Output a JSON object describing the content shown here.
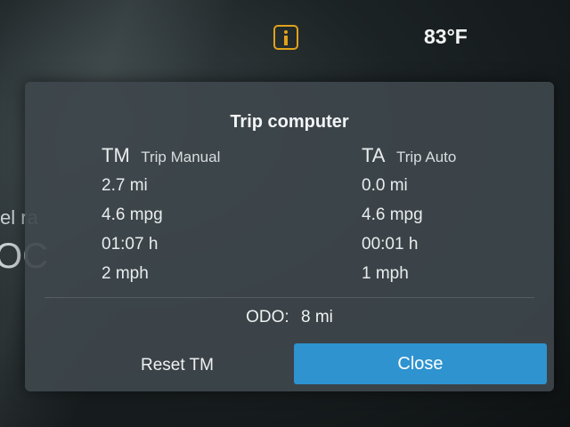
{
  "status_bar": {
    "info_icon": "info-icon",
    "temperature": "83°F",
    "warning_color": "#e0a21a"
  },
  "background_hint": {
    "line1": "el ra",
    "line2": "OC"
  },
  "dialog": {
    "title": "Trip computer",
    "trip_manual": {
      "abbr": "TM",
      "name": "Trip Manual",
      "distance": "2.7 mi",
      "economy": "4.6 mpg",
      "time": "01:07 h",
      "speed": "2 mph"
    },
    "trip_auto": {
      "abbr": "TA",
      "name": "Trip Auto",
      "distance": "0.0 mi",
      "economy": "4.6 mpg",
      "time": "00:01 h",
      "speed": "1 mph"
    },
    "odo": {
      "label": "ODO:",
      "value": "8 mi"
    },
    "buttons": {
      "reset_label": "Reset TM",
      "close_label": "Close",
      "close_color": "#2e93cf"
    }
  }
}
